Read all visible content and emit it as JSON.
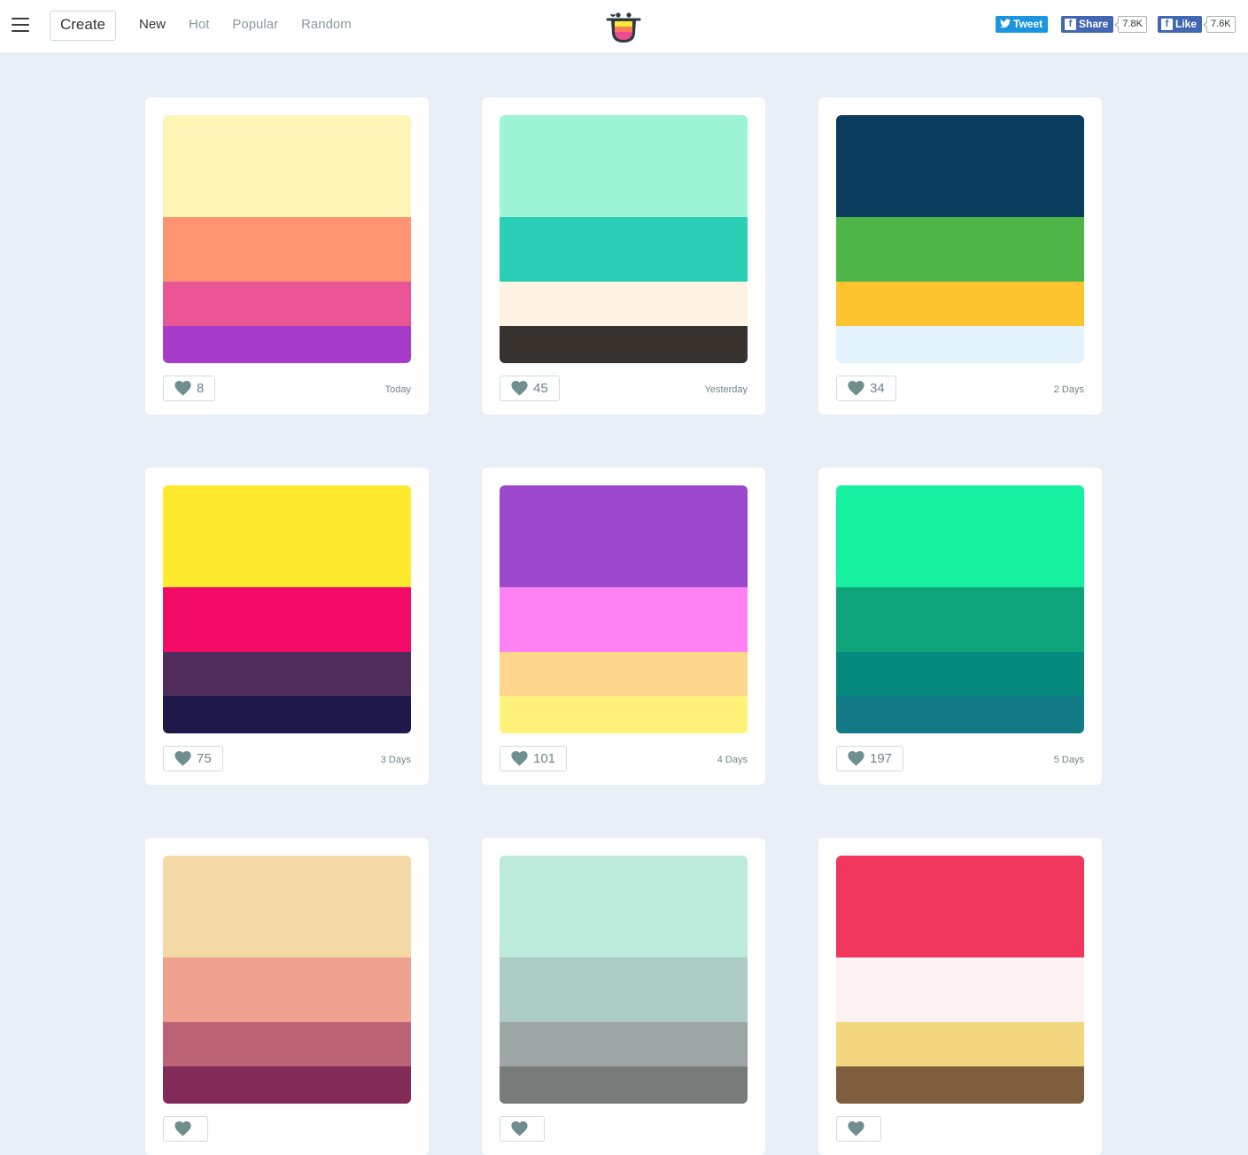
{
  "header": {
    "create_label": "Create",
    "nav": [
      {
        "label": "New",
        "active": true
      },
      {
        "label": "Hot",
        "active": false
      },
      {
        "label": "Popular",
        "active": false
      },
      {
        "label": "Random",
        "active": false
      }
    ],
    "social": {
      "tweet_label": "Tweet",
      "share_label": "Share",
      "share_count": "7.8K",
      "like_label": "Like",
      "like_count": "7.6K"
    }
  },
  "palettes": [
    {
      "colors": [
        "#fef6b6",
        "#ff9472",
        "#e95595",
        "#a73bca"
      ],
      "likes": "8",
      "date": "Today"
    },
    {
      "colors": [
        "#9ef5d6",
        "#2acfb5",
        "#fff4e4",
        "#38322f"
      ],
      "likes": "45",
      "date": "Yesterday"
    },
    {
      "colors": [
        "#093c5d",
        "#4eb648",
        "#fcc530",
        "#e2f3fb"
      ],
      "likes": "34",
      "date": "2 Days"
    },
    {
      "colors": [
        "#fdea2d",
        "#f40a67",
        "#502d5d",
        "#1f184b"
      ],
      "likes": "75",
      "date": "3 Days"
    },
    {
      "colors": [
        "#9b48cd",
        "#ff81f2",
        "#ffd78c",
        "#fff17a"
      ],
      "likes": "101",
      "date": "4 Days"
    },
    {
      "colors": [
        "#16f0a1",
        "#0fa37a",
        "#078a7e",
        "#147a85"
      ],
      "likes": "197",
      "date": "5 Days"
    },
    {
      "colors": [
        "#f4d8a5",
        "#f0a290",
        "#bc6375",
        "#822a58"
      ],
      "likes": "",
      "date": ""
    },
    {
      "colors": [
        "#bceadb",
        "#acccc5",
        "#9da6a4",
        "#777b79"
      ],
      "likes": "",
      "date": ""
    },
    {
      "colors": [
        "#f2375f",
        "#fff2f2",
        "#f3d77e",
        "#7e5e3e"
      ],
      "likes": "",
      "date": ""
    }
  ],
  "icons": {
    "menu": "hamburger-icon",
    "logo": "logo-icon",
    "heart": "heart-icon",
    "twitter": "twitter-icon",
    "facebook": "facebook-icon"
  },
  "colors": {
    "heart": "#6f8f8e",
    "background": "#e8eff6",
    "twitter": "#1b95e0",
    "facebook": "#4267b2"
  }
}
